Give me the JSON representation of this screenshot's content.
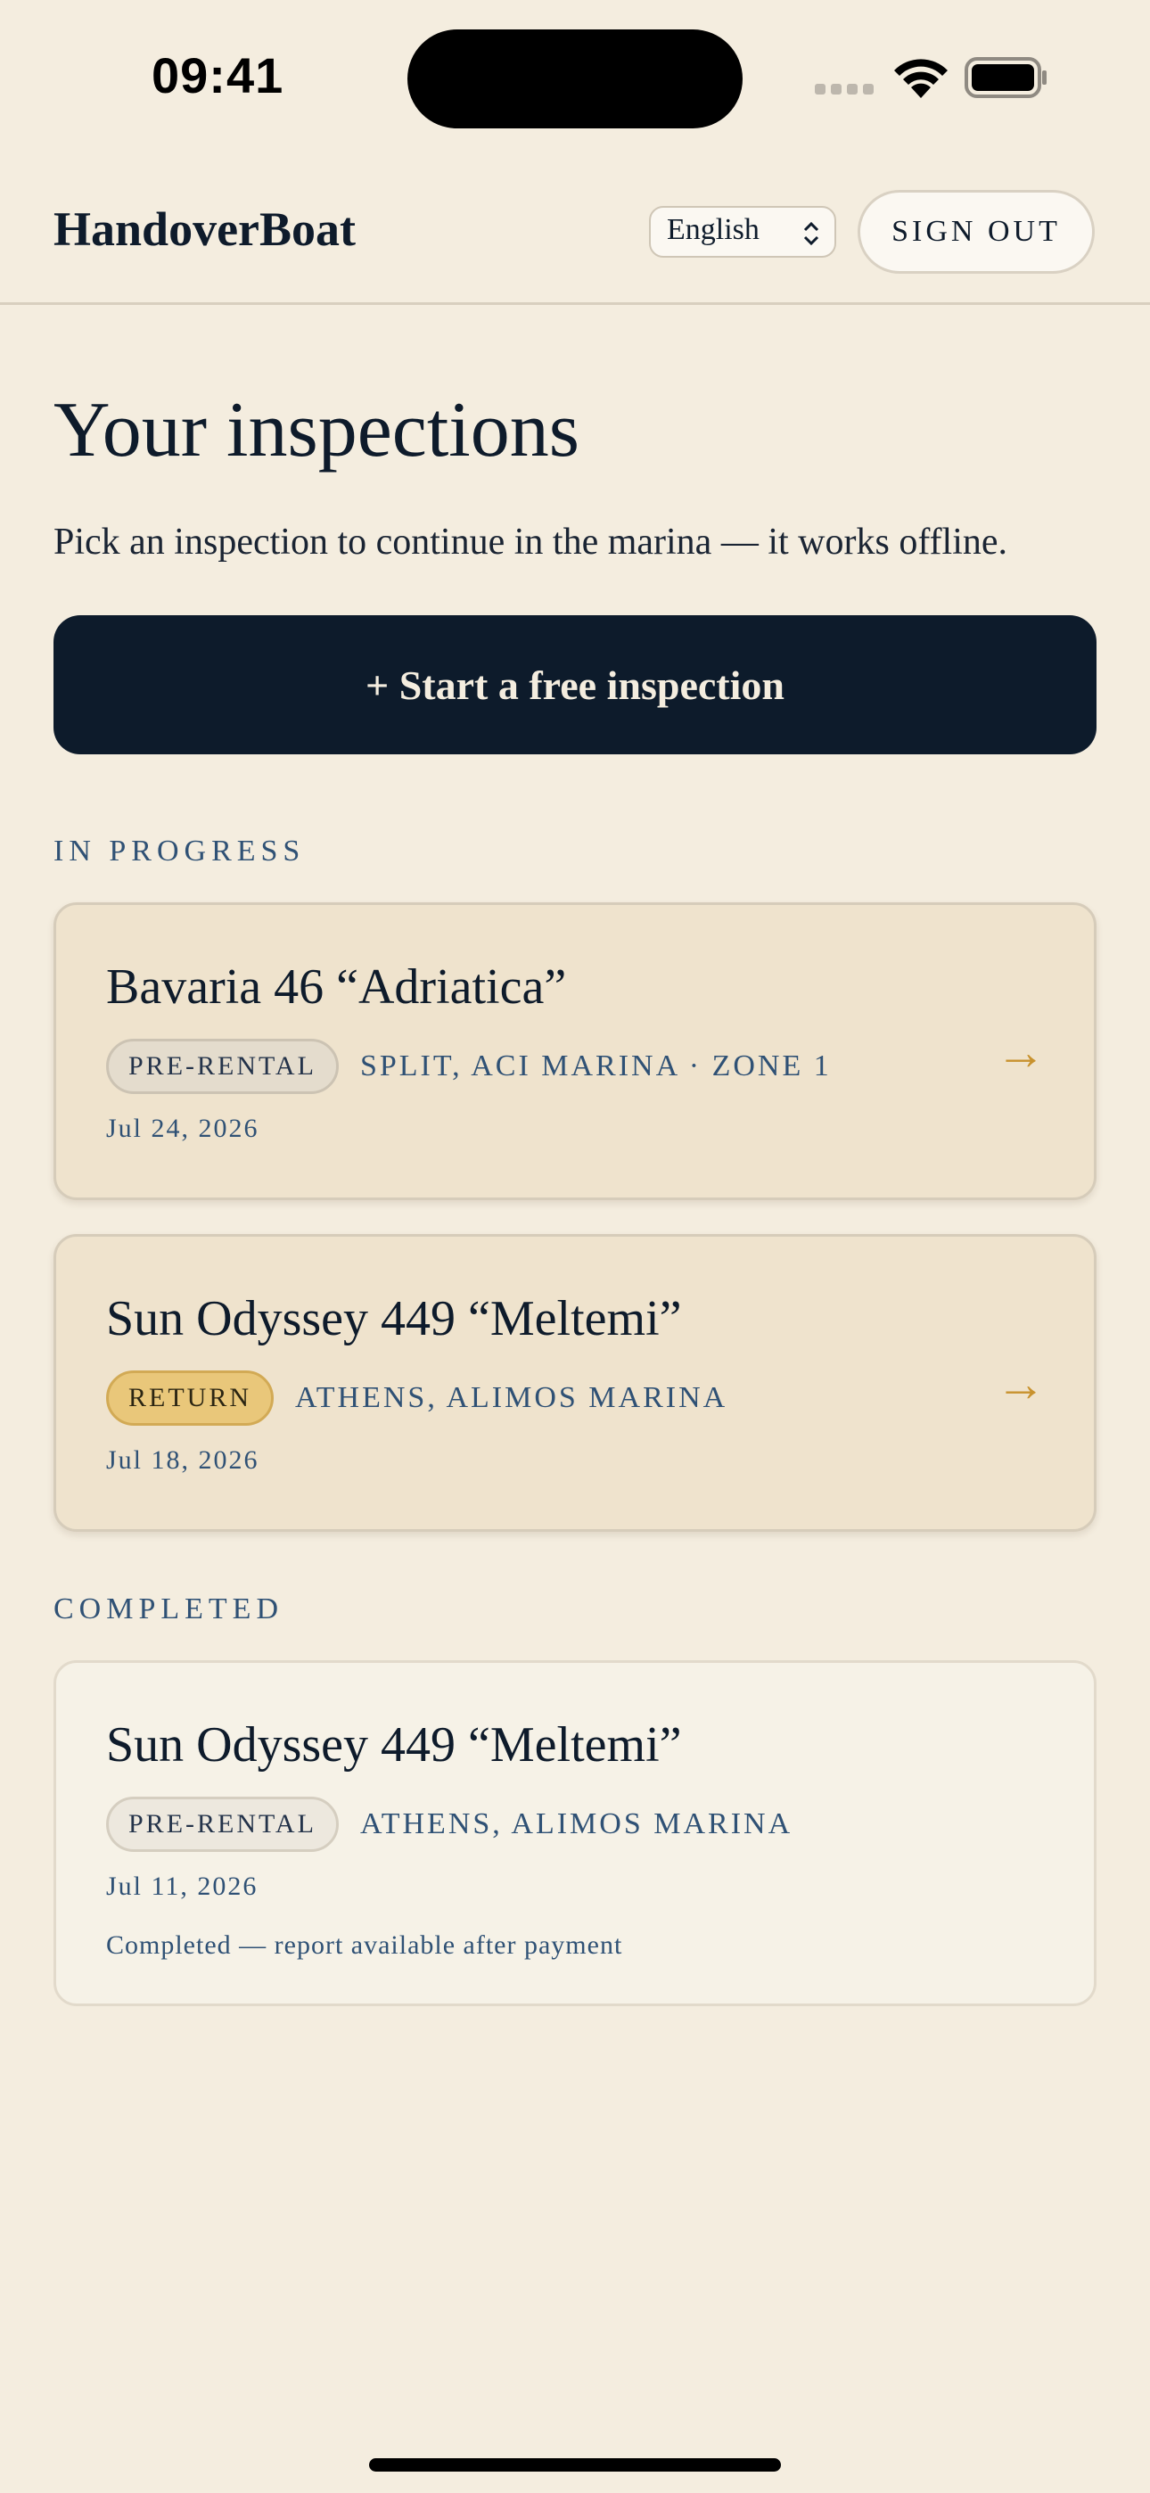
{
  "status_bar": {
    "time": "09:41"
  },
  "header": {
    "brand": "HandoverBoat",
    "language": "English",
    "sign_out_label": "SIGN OUT"
  },
  "main": {
    "title": "Your inspections",
    "subtitle": "Pick an inspection to continue in the marina — it works offline.",
    "cta_label": "+ Start a free inspection"
  },
  "sections": {
    "in_progress": {
      "label": "IN PROGRESS",
      "items": [
        {
          "title": "Bavaria 46 “Adriatica”",
          "badge": "PRE-RENTAL",
          "location": "SPLIT, ACI MARINA · ZONE 1",
          "date": "Jul 24, 2026",
          "arrow": "→"
        },
        {
          "title": "Sun Odyssey 449 “Meltemi”",
          "badge": "RETURN",
          "location": "ATHENS, ALIMOS MARINA",
          "date": "Jul 18, 2026",
          "arrow": "→"
        }
      ]
    },
    "completed": {
      "label": "COMPLETED",
      "items": [
        {
          "title": "Sun Odyssey 449 “Meltemi”",
          "badge": "PRE-RENTAL",
          "location": "ATHENS, ALIMOS MARINA",
          "date": "Jul 11, 2026",
          "note": "Completed — report available after payment"
        }
      ]
    }
  },
  "colors": {
    "background": "#F4EDDF",
    "primary": "#0D1B2B",
    "accent": "#C8922E",
    "muted_blue": "#2F5175",
    "return_badge": "#E9C77A"
  }
}
